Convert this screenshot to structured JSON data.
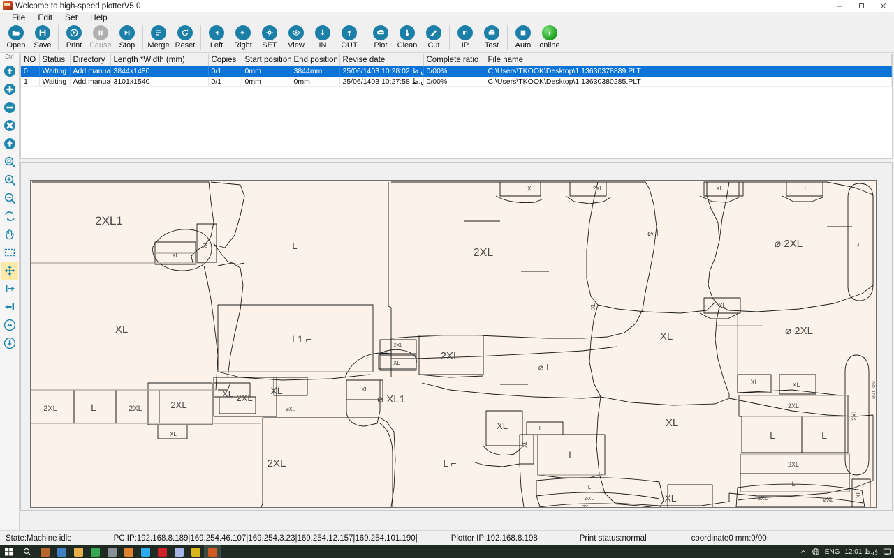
{
  "window": {
    "title": "Welcome to high-speed plotterV5.0",
    "app_icon": "plotter-app-icon",
    "minimize": "minimize-icon",
    "maximize": "maximize-icon",
    "close": "close-icon"
  },
  "menu": [
    {
      "label": "File"
    },
    {
      "label": "Edit"
    },
    {
      "label": "Set"
    },
    {
      "label": "Help"
    }
  ],
  "toolbar": [
    {
      "label": "Open",
      "icon": "folder-open-icon",
      "disabled": false
    },
    {
      "label": "Save",
      "icon": "floppy-save-icon",
      "disabled": false
    },
    {
      "sep": true
    },
    {
      "label": "Print",
      "icon": "play-print-icon",
      "disabled": false
    },
    {
      "label": "Pause",
      "icon": "pause-icon",
      "disabled": true
    },
    {
      "label": "Stop",
      "icon": "stop-skip-icon",
      "disabled": false
    },
    {
      "sep": true
    },
    {
      "label": "Merge",
      "icon": "merge-lines-icon",
      "disabled": false
    },
    {
      "label": "Reset",
      "icon": "refresh-reset-icon",
      "disabled": false
    },
    {
      "sep": true
    },
    {
      "label": "Left",
      "icon": "arrow-left-icon",
      "disabled": false
    },
    {
      "label": "Right",
      "icon": "arrow-right-icon",
      "disabled": false
    },
    {
      "label": "SET",
      "icon": "gear-icon",
      "disabled": false
    },
    {
      "label": "View",
      "icon": "eye-view-icon",
      "disabled": false
    },
    {
      "label": "IN",
      "icon": "arrow-down-in-icon",
      "disabled": false
    },
    {
      "label": "OUT",
      "icon": "arrow-up-out-icon",
      "disabled": false
    },
    {
      "sep": true
    },
    {
      "label": "Plot",
      "icon": "plotter-icon",
      "disabled": false
    },
    {
      "label": "Clean",
      "icon": "brush-clean-icon",
      "disabled": false
    },
    {
      "label": "Cut",
      "icon": "knife-cut-icon",
      "disabled": false
    },
    {
      "sep": true
    },
    {
      "label": "IP",
      "icon": "ip-icon",
      "disabled": false
    },
    {
      "label": "Test",
      "icon": "test-printer-icon",
      "disabled": false
    },
    {
      "sep": true
    },
    {
      "label": "Auto",
      "icon": "auto-square-icon",
      "disabled": false
    },
    {
      "label": "online",
      "icon": "online-status-icon",
      "disabled": false
    }
  ],
  "rail": {
    "caption": "Ctrl",
    "items": [
      {
        "icon": "move-up-circle-icon",
        "active": false
      },
      {
        "icon": "zoom-plus-circle-icon",
        "active": false
      },
      {
        "icon": "zoom-minus-circle-icon",
        "active": false
      },
      {
        "icon": "delete-x-circle-icon",
        "active": false
      },
      {
        "icon": "up-arrow-circle-icon",
        "active": false
      },
      {
        "icon": "zoom-fit-icon",
        "active": false
      },
      {
        "icon": "zoom-in-icon",
        "active": false
      },
      {
        "icon": "zoom-out-icon",
        "active": false
      },
      {
        "icon": "rotate-icon",
        "active": false
      },
      {
        "icon": "hand-pan-icon",
        "active": false
      },
      {
        "icon": "marquee-select-icon",
        "active": false
      },
      {
        "icon": "move-all-icon",
        "active": true
      },
      {
        "icon": "align-right-icon",
        "active": false
      },
      {
        "icon": "align-left-icon",
        "active": false
      },
      {
        "icon": "feed-down-icon",
        "active": false
      },
      {
        "icon": "feed-pen-icon",
        "active": false
      }
    ]
  },
  "table": {
    "columns": [
      "NO",
      "Status",
      "Directory",
      "Length *Width (mm)",
      "Copies",
      "Start position",
      "End position",
      "Revise date",
      "Complete ratio",
      "File name"
    ],
    "rows": [
      {
        "no": "0",
        "status": "Waiting",
        "directory": "Add manually",
        "length_width": "3844x1480",
        "copies": "0/1",
        "start_position": "0mm",
        "end_position": "3844mm",
        "revise_date": "25/06/1403 10:28:02 ق.ظ",
        "complete_ratio": "0/00%",
        "file_name": "C:\\Users\\TKOOK\\Desktop\\1  13630378889.PLT",
        "selected": true
      },
      {
        "no": "1",
        "status": "Waiting",
        "directory": "Add manually",
        "length_width": "3101x1540",
        "copies": "0/1",
        "start_position": "0mm",
        "end_position": "0mm",
        "revise_date": "25/06/1403 10:27:58 ق.ظ",
        "complete_ratio": "0/00%",
        "file_name": "C:\\Users\\TKOOK\\Desktop\\1  13630380285.PLT",
        "selected": false
      }
    ]
  },
  "plot": {
    "canvas_name": "marker-nesting-canvas",
    "background_color": "#fdf2e9",
    "outline_color": "#1a1a1a",
    "grain_line_color": "#a9a59d",
    "piece_labels": [
      "2XL1",
      "XL",
      "XL",
      "L",
      "XL",
      "2XL",
      "2XL",
      "XL",
      "L",
      "2XL",
      "L",
      "XL",
      "2XL",
      "L1",
      "2XL",
      "2XL",
      "XL",
      "XL",
      "XL",
      "XL",
      "XL",
      "2XL",
      "L",
      "2XL",
      "XL",
      "XL",
      "XL1",
      "2XL",
      "L",
      "XL",
      "L",
      "2XL",
      "XL",
      "2XL",
      "L",
      "L",
      "2XL",
      "L",
      "XL",
      "XL",
      "2XL",
      "XL",
      "XL"
    ],
    "right_edge_text": "BOTTOM"
  },
  "status": {
    "state": "State:Machine idle",
    "pc_ip": "PC IP:192.168.8.189|169.254.46.107|169.254.3.23|169.254.12.157|169.254.101.190|",
    "plotter_ip": "Plotter IP:192.168.8.198",
    "print_status": "Print status:normal",
    "coordinate": "coordinate0 mm:0/00"
  },
  "taskbar": {
    "start": "windows-start-icon",
    "search": "search-icon",
    "apps": [
      {
        "name": "photos-app-icon",
        "color": "#b8672f",
        "active": false
      },
      {
        "name": "this-pc-icon",
        "color": "#3f7fc4",
        "active": false
      },
      {
        "name": "file-explorer-icon",
        "color": "#e8b04b",
        "active": false
      },
      {
        "name": "chrome-icon",
        "color": "#35a853",
        "active": false
      },
      {
        "name": "calculator-icon",
        "color": "#8a8f95",
        "active": false
      },
      {
        "name": "media-player-icon",
        "color": "#e2812c",
        "active": false
      },
      {
        "name": "telegram-icon",
        "color": "#2aabee",
        "active": false
      },
      {
        "name": "illustrator-icon",
        "color": "#cc2027",
        "active": false
      },
      {
        "name": "photoshop-icon",
        "color": "#a8b4e8",
        "active": false
      },
      {
        "name": "corel-icon",
        "color": "#d9b41a",
        "active": false
      },
      {
        "name": "plotter-app-icon",
        "color": "#d05a23",
        "active": true
      }
    ],
    "tray": {
      "chevron": "show-hidden-icons-chevron",
      "network": "network-globe-icon",
      "language": "ENG",
      "clock": "12:01 ق.ظ",
      "notifications": "notification-center-icon"
    }
  }
}
